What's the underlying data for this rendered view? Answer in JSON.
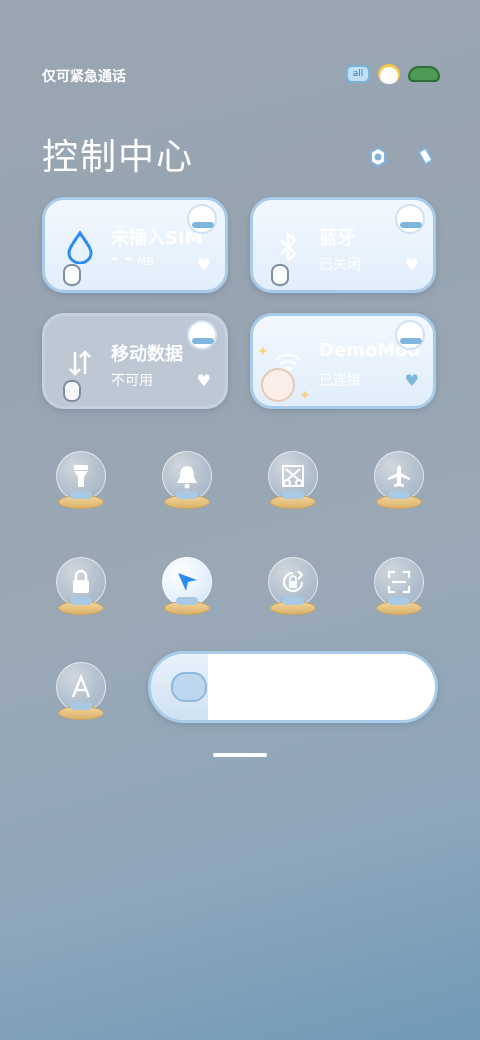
{
  "status_bar": {
    "emergency_text": "仅可紧急通话",
    "battery_level_text": "all"
  },
  "header": {
    "title": "控制中心"
  },
  "tiles": {
    "data": {
      "title": "未插入SIM",
      "value": "- -",
      "unit": "MB"
    },
    "bluetooth": {
      "title": "蓝牙",
      "status": "已关闭"
    },
    "mobile_data": {
      "title": "移动数据",
      "status": "不可用"
    },
    "wifi": {
      "title": "DemoMod",
      "status": "已连接"
    }
  },
  "toggles": [
    {
      "name": "flashlight",
      "icon": "flashlight-icon",
      "active": false
    },
    {
      "name": "bell",
      "icon": "bell-icon",
      "active": false
    },
    {
      "name": "screenshot",
      "icon": "scissors-icon",
      "active": false
    },
    {
      "name": "airplane",
      "icon": "airplane-icon",
      "active": false
    },
    {
      "name": "lock",
      "icon": "lock-icon",
      "active": false
    },
    {
      "name": "location",
      "icon": "location-arrow-icon",
      "active": true
    },
    {
      "name": "rotation",
      "icon": "rotation-lock-icon",
      "active": false
    },
    {
      "name": "scan",
      "icon": "scan-icon",
      "active": false
    },
    {
      "name": "auto-brightness",
      "icon": "auto-brightness-icon",
      "active": false
    }
  ],
  "brightness": {
    "level": 0.2
  },
  "colors": {
    "accent": "#2d8cf0",
    "tile_border": "#a9cbea",
    "tile_bg": "#eef5fd"
  }
}
